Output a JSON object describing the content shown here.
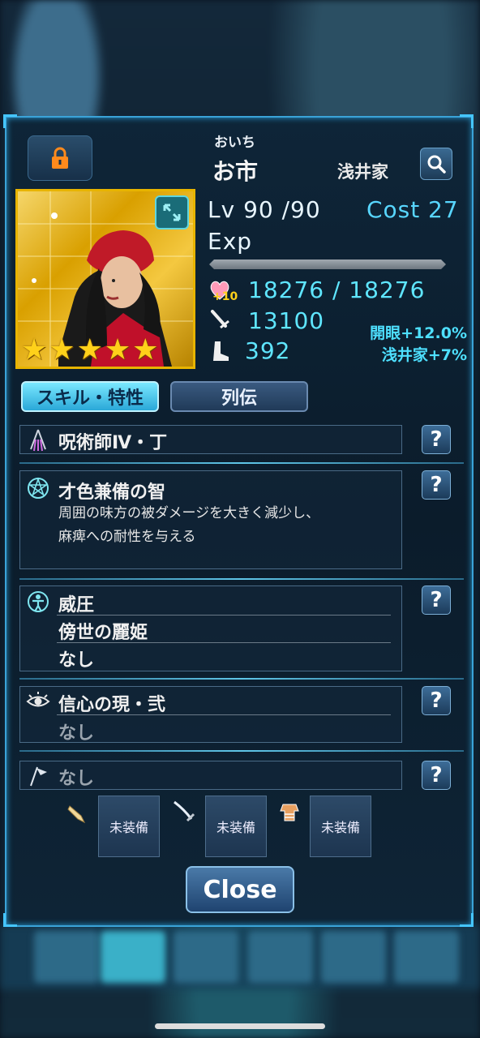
{
  "character": {
    "kana": "おいち",
    "name": "お市",
    "clan": "浅井家"
  },
  "stats": {
    "lv_label": "Lv 90 /90",
    "cost_label": "Cost",
    "cost_value": "27",
    "exp_label": "Exp",
    "exp_progress": 1.0,
    "hp_bonus": "+10",
    "hp": "18276 / 18276",
    "attack": "13100",
    "speed": "392",
    "bonus_1": "開眼+12.0%",
    "bonus_2": "浅井家+7%"
  },
  "rarity_stars": 5,
  "tabs": [
    {
      "label": "スキル・特性",
      "active": true
    },
    {
      "label": "列伝",
      "active": false
    }
  ],
  "skills": {
    "class": "呪術師Ⅳ・丁",
    "main_skill_name": "才色兼備の智",
    "main_skill_desc_1": "周囲の味方の被ダメージを大きく減少し、",
    "main_skill_desc_2": "麻痺への耐性を与える",
    "trait_1": "威圧",
    "trait_2": "傍世の麗姫",
    "trait_3": "なし",
    "belief_name": "信心の現・弐",
    "belief_value": "なし",
    "flag_value": "なし"
  },
  "equipment": {
    "slot_1": "未装備",
    "slot_2": "未装備",
    "slot_3": "未装備"
  },
  "close_label": "Close",
  "help_label": "?",
  "colors": {
    "accent": "#45c6ff",
    "stat_cyan": "#5fe6ff",
    "star_gold": "#ffd11a",
    "lock_orange": "#ff8a1c"
  }
}
